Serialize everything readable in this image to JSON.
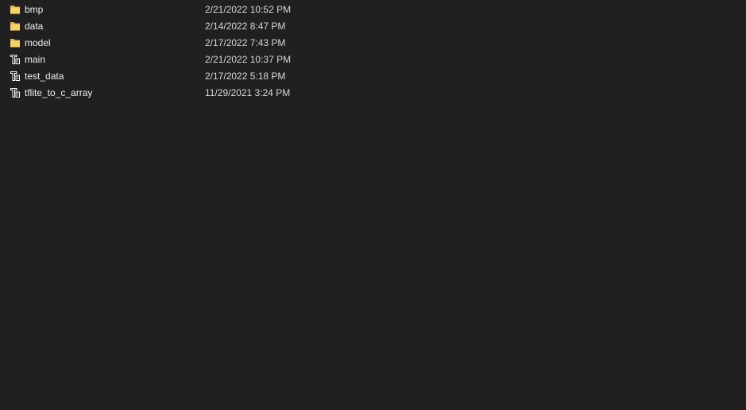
{
  "files": [
    {
      "name": "bmp",
      "modified": "2/21/2022 10:52 PM",
      "type": "folder",
      "icon": "folder-icon"
    },
    {
      "name": "data",
      "modified": "2/14/2022 8:47 PM",
      "type": "folder",
      "icon": "folder-icon"
    },
    {
      "name": "model",
      "modified": "2/17/2022 7:43 PM",
      "type": "folder",
      "icon": "folder-icon"
    },
    {
      "name": "main",
      "modified": "2/21/2022 10:37 PM",
      "type": "file",
      "icon": "source-file-icon"
    },
    {
      "name": "test_data",
      "modified": "2/17/2022 5:18 PM",
      "type": "file",
      "icon": "source-file-icon"
    },
    {
      "name": "tflite_to_c_array",
      "modified": "11/29/2021 3:24 PM",
      "type": "file",
      "icon": "source-file-icon"
    }
  ],
  "colors": {
    "background": "#202020",
    "folder": "#f5c94a",
    "file_icon": "#ffffff",
    "text": "#f0f0f0",
    "date_text": "#d6d6d6"
  }
}
